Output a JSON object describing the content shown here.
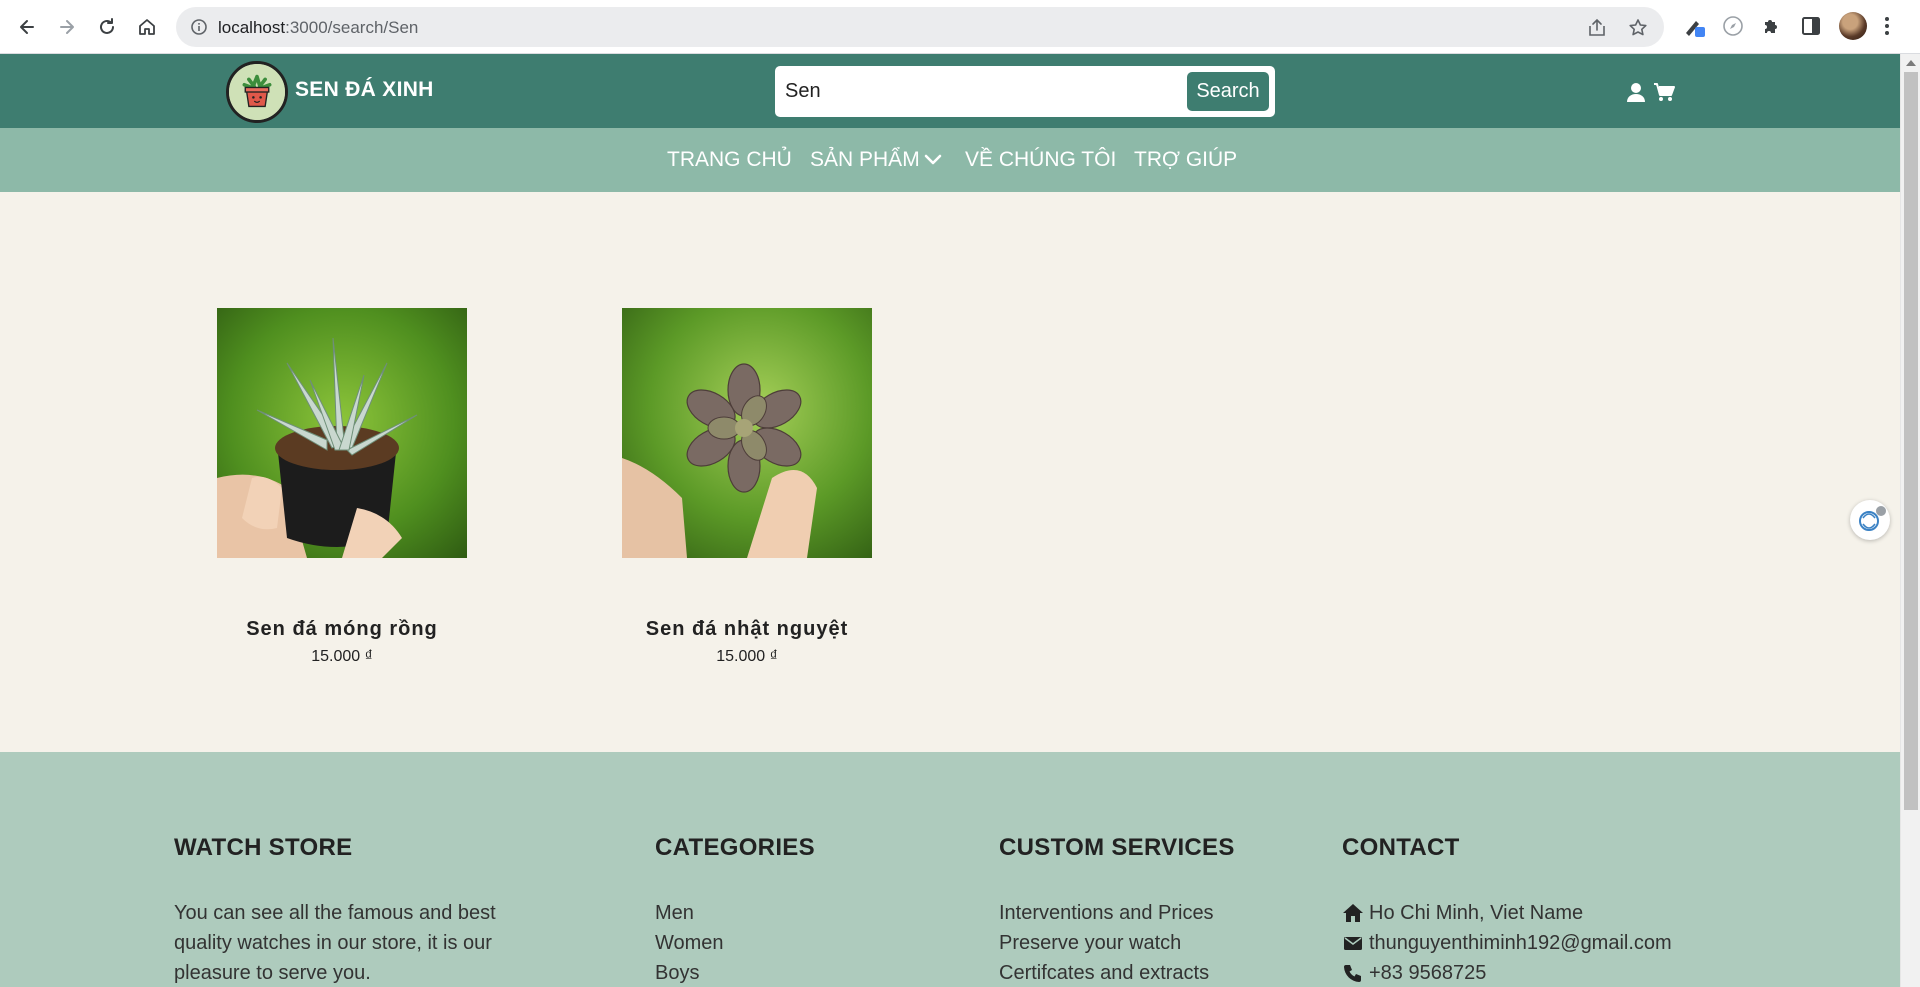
{
  "browser": {
    "url_host": "localhost",
    "url_path": ":3000/search/Sen",
    "icons": [
      "back-icon",
      "forward-icon",
      "reload-icon",
      "home-icon",
      "site-info-icon",
      "share-icon",
      "bookmark-star-icon",
      "pen-extension-icon",
      "compass-extension-icon",
      "puzzle-extensions-icon",
      "side-panel-icon",
      "profile-avatar",
      "more-menu-icon"
    ]
  },
  "header": {
    "brand": "SEN ĐÁ XINH",
    "search": {
      "value": "Sen",
      "placeholder": "",
      "button_label": "Search"
    },
    "icons": [
      "user-icon",
      "cart-icon"
    ]
  },
  "nav": {
    "items": [
      {
        "label": "TRANG CHỦ"
      },
      {
        "label": "SẢN PHẨM"
      },
      {
        "label": "VỀ CHÚNG TÔI"
      },
      {
        "label": "TRỢ GIÚP"
      }
    ]
  },
  "products": [
    {
      "name": "Sen đá móng rồng",
      "price": "15.000 ₫"
    },
    {
      "name": "Sen đá nhật nguyệt",
      "price": "15.000 ₫"
    }
  ],
  "footer": {
    "about": {
      "title": "WATCH STORE",
      "text": "You can see all the famous and best quality watches in our store, it is our pleasure to serve you."
    },
    "categories": {
      "title": "CATEGORIES",
      "items": [
        "Men",
        "Women",
        "Boys"
      ]
    },
    "services": {
      "title": "CUSTOM SERVICES",
      "items": [
        "Interventions and Prices",
        "Preserve your watch",
        "Certifcates and extracts"
      ]
    },
    "contact": {
      "title": "CONTACT",
      "address": "Ho Chi Minh, Viet Name",
      "email": "thunguyenthiminh192@gmail.com",
      "phone": "+83 9568725"
    }
  },
  "colors": {
    "header": "#3e7d70",
    "nav": "#8db9a8",
    "page": "#f5f2ea",
    "footer": "#aecbbd"
  }
}
